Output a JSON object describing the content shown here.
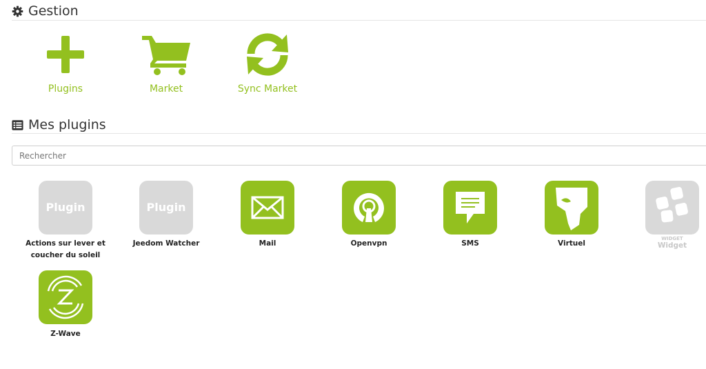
{
  "gestion": {
    "title": "Gestion",
    "items": [
      {
        "label": "Plugins",
        "icon": "plus-icon"
      },
      {
        "label": "Market",
        "icon": "shopping-cart-icon"
      },
      {
        "label": "Sync Market",
        "icon": "refresh-icon"
      }
    ]
  },
  "mes_plugins": {
    "title": "Mes plugins",
    "search_placeholder": "Rechercher"
  },
  "plugins": [
    {
      "name": "Actions sur lever et coucher du soleil",
      "tile_text": "Plugin",
      "style": "grey-placeholder"
    },
    {
      "name": "Jeedom Watcher",
      "tile_text": "Plugin",
      "style": "grey-placeholder"
    },
    {
      "name": "Mail",
      "icon": "envelope-icon",
      "style": "green"
    },
    {
      "name": "Openvpn",
      "icon": "openvpn-icon",
      "style": "green"
    },
    {
      "name": "SMS",
      "icon": "sms-icon",
      "style": "green"
    },
    {
      "name": "Virtuel",
      "icon": "mask-icon",
      "style": "green"
    },
    {
      "name": "Widget",
      "tile_text": "WIDGET",
      "icon": "widget-icon",
      "style": "disabled"
    },
    {
      "name": "Z-Wave",
      "icon": "zwave-icon",
      "style": "green"
    }
  ],
  "colors": {
    "accent": "#93c01f",
    "disabled": "#d9d9d9",
    "text": "#333333"
  }
}
